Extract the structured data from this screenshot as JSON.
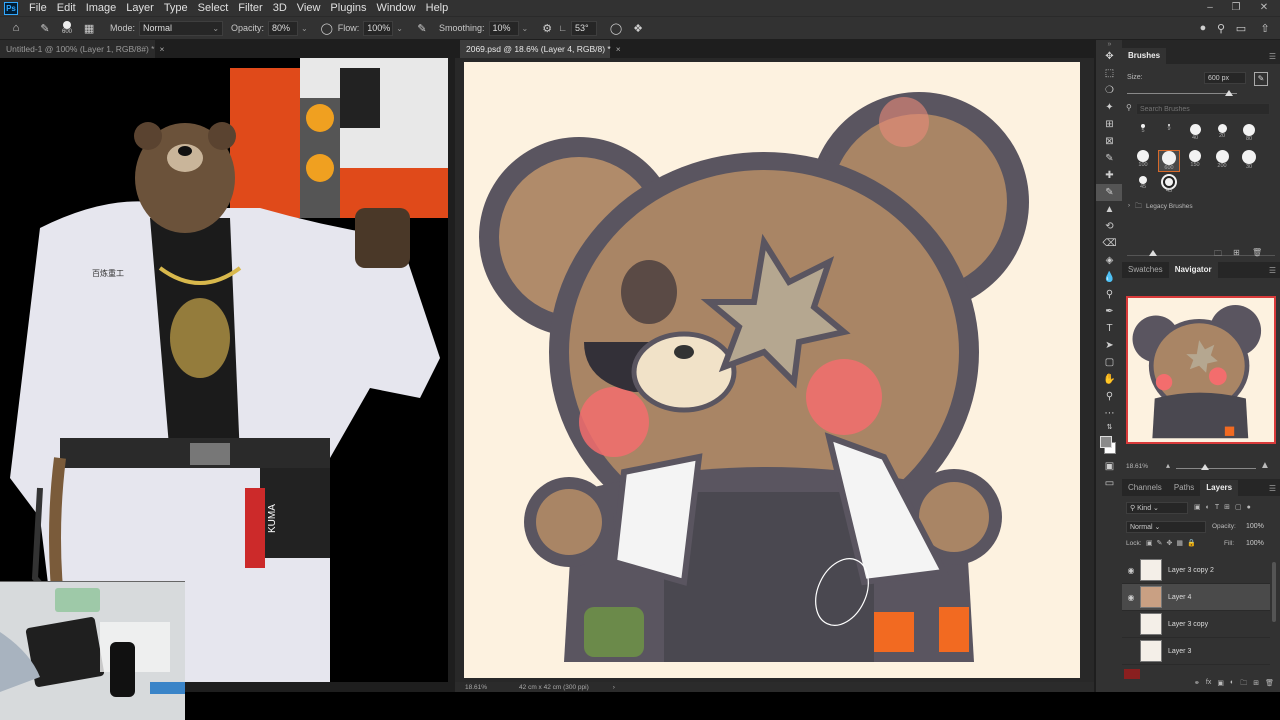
{
  "menu": {
    "logo": "Ps",
    "items": [
      "File",
      "Edit",
      "Image",
      "Layer",
      "Type",
      "Select",
      "Filter",
      "3D",
      "View",
      "Plugins",
      "Window",
      "Help"
    ]
  },
  "options": {
    "brush_size": "600",
    "mode_label": "Mode:",
    "mode_value": "Normal",
    "opacity_label": "Opacity:",
    "opacity_value": "80%",
    "flow_label": "Flow:",
    "flow_value": "100%",
    "smoothing_label": "Smoothing:",
    "smoothing_value": "10%",
    "angle_value": "53°"
  },
  "tabs": {
    "left": "Untitled-1 @ 100% (Layer 1, RGB/8#) *",
    "main": "2069.psd @ 18.6% (Layer 4, RGB/8) *"
  },
  "status": {
    "zoom": "18.61%",
    "doc_size": "42 cm x 42 cm (300 ppi)"
  },
  "reference_text": {
    "badge": "百炼重工",
    "tag": "KUMA"
  },
  "brushes": {
    "title": "Brushes",
    "size_label": "Size:",
    "size_value": "600 px",
    "search_placeholder": "Search Brushes",
    "presets": [
      {
        "size": "5",
        "diameter": 4
      },
      {
        "size": "9",
        "diameter": 2
      },
      {
        "size": "40",
        "diameter": 11
      },
      {
        "size": "20",
        "diameter": 9
      },
      {
        "size": "80",
        "diameter": 12
      },
      {
        "size": "100",
        "diameter": 12
      },
      {
        "size": "600",
        "diameter": 14
      },
      {
        "size": "150",
        "diameter": 12
      },
      {
        "size": "200",
        "diameter": 13
      },
      {
        "size": "30",
        "diameter": 14
      },
      {
        "size": "45",
        "diameter": 8
      },
      {
        "size": "45",
        "diameter": 12
      }
    ],
    "folder": "Legacy Brushes"
  },
  "navigator": {
    "tabs": [
      "Swatches",
      "Navigator"
    ],
    "zoom": "18.61%"
  },
  "layers_panel": {
    "tabs": [
      "Channels",
      "Paths",
      "Layers"
    ],
    "filter_value": "Kind",
    "blend_value": "Normal",
    "opacity_label": "Opacity:",
    "opacity_value": "100%",
    "lock_label": "Lock:",
    "fill_label": "Fill:",
    "fill_value": "100%",
    "layers": [
      {
        "name": "Layer 3 copy 2",
        "visible": true,
        "selected": false
      },
      {
        "name": "Layer 4",
        "visible": true,
        "selected": true
      },
      {
        "name": "Layer 3 copy",
        "visible": false,
        "selected": false
      },
      {
        "name": "Layer 3",
        "visible": false,
        "selected": false
      }
    ]
  },
  "colors": {
    "foreground": "#8a1f1f",
    "canvas_bg": "#fdf2e0",
    "accent_orange": "#f26a21",
    "blush": "#f36d6d"
  }
}
